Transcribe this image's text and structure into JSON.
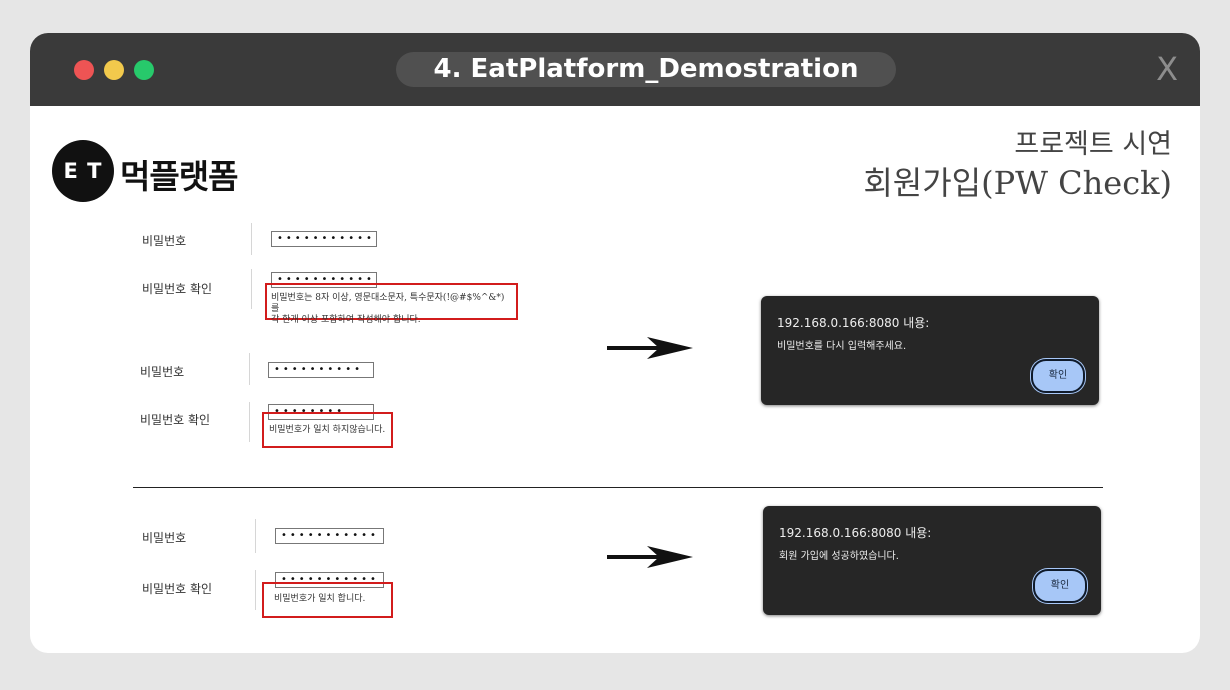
{
  "window": {
    "title": "4. EatPlatform_Demostration",
    "close_label": "X"
  },
  "logo": {
    "badge": "E T",
    "name": "먹플랫폼"
  },
  "heading": {
    "line1": "프로젝트 시연",
    "line2": "회원가입(PW Check)"
  },
  "panel1": {
    "pw_label": "비밀번호",
    "pw_value": "•••••••••••",
    "confirm_label": "비밀번호 확인",
    "confirm_value": "•••••••••••",
    "message_line1": "비밀번호는 8자 이상, 영문대소문자, 특수문자(!@#$%^&*)를",
    "message_line2": "각 한개 이상 포함하여 작성해야 합니다."
  },
  "panel2": {
    "pw_label": "비밀번호",
    "pw_value": "••••••••••",
    "confirm_label": "비밀번호 확인",
    "confirm_value": "••••••••",
    "message": "비밀번호가 일치 하지않습니다."
  },
  "panel3": {
    "pw_label": "비밀번호",
    "pw_value": "•••••••••••",
    "confirm_label": "비밀번호 확인",
    "confirm_value": "•••••••••••",
    "message": "비밀번호가 일치 합니다."
  },
  "dialog1": {
    "title": "192.168.0.166:8080 내용:",
    "message": "비밀번호를 다시 입력해주세요.",
    "button": "확인"
  },
  "dialog2": {
    "title": "192.168.0.166:8080 내용:",
    "message": "회원 가입에 성공하였습니다.",
    "button": "확인"
  }
}
